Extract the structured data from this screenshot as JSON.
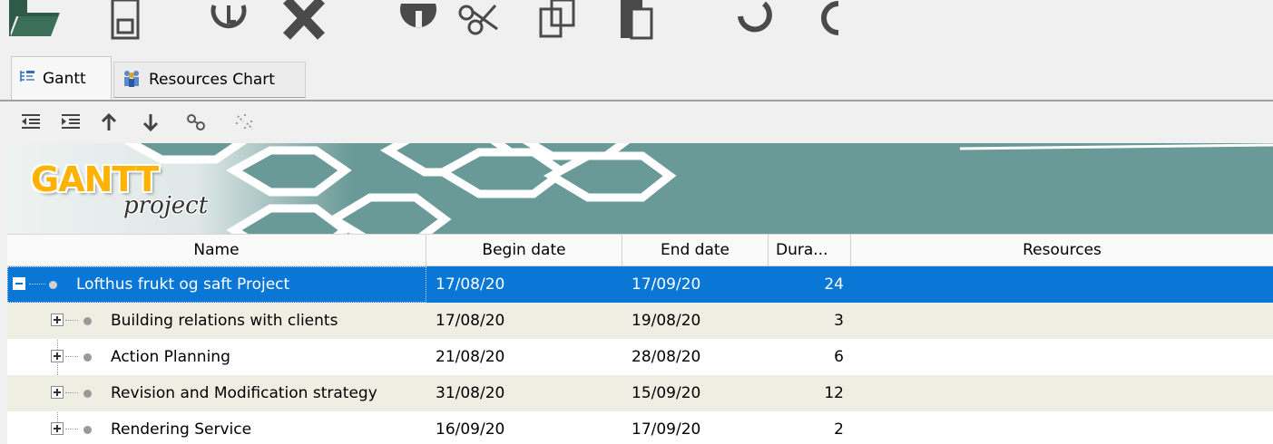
{
  "tabs": [
    {
      "label": "Gantt",
      "icon": "gantt-tree-icon",
      "active": true
    },
    {
      "label": "Resources Chart",
      "icon": "people-icon",
      "active": false
    }
  ],
  "toolbar_icons": [
    "open-folder-icon",
    "save-icon",
    "clock-icon",
    "delete-icon",
    "info-icon",
    "cut-icon",
    "copy-icon",
    "paste-icon",
    "undo-icon",
    "redo-icon"
  ],
  "sub_toolbar_icons": [
    "outdent-icon",
    "indent-icon",
    "move-up-icon",
    "move-down-icon",
    "link-icon",
    "unlink-icon"
  ],
  "logo": {
    "main": "GANTT",
    "sub": "project",
    "color": "#ffb300"
  },
  "columns": {
    "name": "Name",
    "begin": "Begin date",
    "end": "End date",
    "duration": "Dura...",
    "resources": "Resources"
  },
  "rows": [
    {
      "name": "Lofthus frukt og saft Project",
      "begin": "17/08/20",
      "end": "17/09/20",
      "duration": "24",
      "resources": "",
      "level": 0,
      "expanded": true,
      "selected": true
    },
    {
      "name": "Building relations with clients",
      "begin": "17/08/20",
      "end": "19/08/20",
      "duration": "3",
      "resources": "",
      "level": 1,
      "expanded": false,
      "selected": false
    },
    {
      "name": "Action Planning",
      "begin": "21/08/20",
      "end": "28/08/20",
      "duration": "6",
      "resources": "",
      "level": 1,
      "expanded": false,
      "selected": false
    },
    {
      "name": "Revision and Modification strategy",
      "begin": "31/08/20",
      "end": "15/09/20",
      "duration": "12",
      "resources": "",
      "level": 1,
      "expanded": false,
      "selected": false
    },
    {
      "name": "Rendering Service",
      "begin": "16/09/20",
      "end": "17/09/20",
      "duration": "2",
      "resources": "",
      "level": 1,
      "expanded": false,
      "selected": false
    }
  ],
  "colors": {
    "selection": "#0a77d6",
    "alt_row": "#eeeee2",
    "banner": "#6a9a98"
  }
}
